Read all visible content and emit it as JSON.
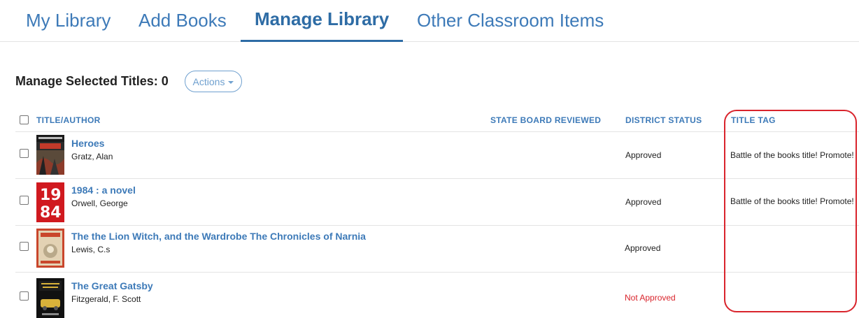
{
  "tabs": [
    {
      "label": "My Library"
    },
    {
      "label": "Add Books"
    },
    {
      "label": "Manage Library"
    },
    {
      "label": "Other Classroom Items"
    }
  ],
  "manage": {
    "label": "Manage Selected Titles: 0",
    "actions_label": "Actions"
  },
  "table": {
    "headers": {
      "title": "TITLE",
      "separator": "/",
      "author": "AUTHOR",
      "state_board": "STATE BOARD REVIEWED",
      "district_status": "DISTRICT STATUS",
      "title_tag": "TITLE TAG"
    },
    "rows": [
      {
        "title": "Heroes",
        "author": "Gratz, Alan",
        "state_board": "",
        "district_status": "Approved",
        "title_tag": "Battle of the books title! Promote!"
      },
      {
        "title": "1984 : a novel",
        "author": "Orwell, George",
        "state_board": "",
        "district_status": "Approved",
        "title_tag": "Battle of the books title! Promote!"
      },
      {
        "title": "The the Lion Witch, and the Wardrobe The Chronicles of Narnia",
        "author": "Lewis, C.s",
        "state_board": "",
        "district_status": "Approved",
        "title_tag": ""
      },
      {
        "title": "The Great Gatsby",
        "author": "Fitzgerald, F. Scott",
        "state_board": "",
        "district_status": "Not Approved",
        "title_tag": ""
      }
    ]
  },
  "colors": {
    "link": "#3d7ab8",
    "active_tab": "#2e6ca5",
    "not_approved": "#d9242c",
    "highlight": "#d9242c"
  }
}
